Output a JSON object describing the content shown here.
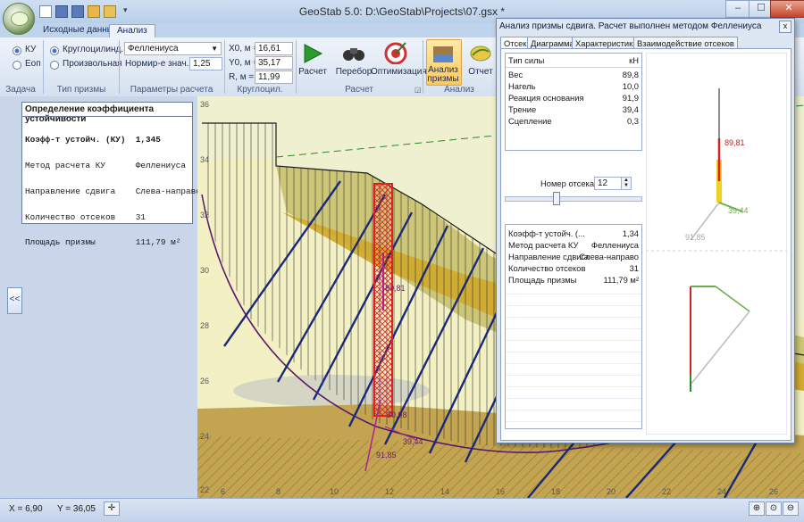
{
  "window": {
    "title": "GeoStab 5.0:  D:\\GeoStab\\Projects\\07.gsx *",
    "minimize_label": "–",
    "maximize_label": "☐",
    "close_label": "✕"
  },
  "ribbon_tabs": [
    "Исходные данные",
    "Анализ"
  ],
  "ribbon": {
    "task_group": {
      "caption": "Задача",
      "options": [
        "КУ",
        "Еоп"
      ]
    },
    "prism_group": {
      "caption": "Тип призмы",
      "options": [
        "Круглоцилинд.",
        "Произвольная"
      ]
    },
    "calc_params": {
      "caption": "Параметры расчета",
      "method": "Феллениуса",
      "norm_label": "Нормир-е знач. Ку",
      "norm_value": "1,25"
    },
    "circle_prism": {
      "caption": "Круглоцил. призма",
      "x0_label": "X0, м =",
      "x0": "16,61",
      "y0_label": "Y0, м =",
      "y0": "35,17",
      "r_label": "R, м =",
      "r": "11,99"
    },
    "calc_group": {
      "caption": "Расчет",
      "calc": "Расчет",
      "search": "Перебор",
      "optimize": "Оптимизация"
    },
    "analysis_group": {
      "caption": "Анализ",
      "prism_analysis_l1": "Анализ",
      "prism_analysis_l2": "призмы",
      "report": "Отчет"
    }
  },
  "left_panel": {
    "title": "Определение коэффициента устойчивости",
    "lines": [
      "Коэфф-т устойч. (КУ)  1,345",
      "Метод расчета КУ      Феллениуса",
      "Направление сдвига    Слева-направо",
      "Количество отсеков    31",
      "Площадь призмы        111,79 м²"
    ],
    "collapse_label": "<<"
  },
  "status": {
    "x": "X = 6,90",
    "y": "Y = 36,05"
  },
  "plot": {
    "y_ticks": [
      "36",
      "34",
      "32",
      "30",
      "28",
      "26",
      "24",
      "22"
    ],
    "x_ticks": [
      "6",
      "8",
      "10",
      "12",
      "14",
      "16",
      "18",
      "20",
      "22",
      "24",
      "26"
    ],
    "labels": {
      "force_a": "89,81",
      "force_b": "30,98",
      "force_c": "91,85",
      "force_d": "39,44"
    }
  },
  "dialog": {
    "title": "Анализ призмы сдвига. Расчет выполнен методом Феллениуса",
    "tabs": [
      "Отсек",
      "Диаграмма",
      "Характеристики",
      "Взаимодействие отсеков"
    ],
    "forces_header": {
      "type": "Тип силы",
      "unit": "кН"
    },
    "forces": [
      {
        "k": "Вес",
        "v": "89,8"
      },
      {
        "k": "Нагель",
        "v": "10,0"
      },
      {
        "k": "Реакция основания",
        "v": "91,9"
      },
      {
        "k": "Трение",
        "v": "39,4"
      },
      {
        "k": "Сцепление",
        "v": "0,3"
      }
    ],
    "section_label": "Номер отсека",
    "section_value": "12",
    "summary": [
      {
        "k": "Коэфф-т устойч. (...",
        "v": "1,34"
      },
      {
        "k": "Метод расчета КУ",
        "v": "Феллениуса"
      },
      {
        "k": "Направление сдвига",
        "v": "Слева-направо"
      },
      {
        "k": "Количество отсеков",
        "v": "31"
      },
      {
        "k": "Площадь призмы",
        "v": "111,79 м²"
      }
    ],
    "diagram_labels": {
      "weight": "89,81",
      "friction": "39,44",
      "reaction": "91,85"
    },
    "close_label": "x"
  },
  "colors": {
    "accent": "#3b74d6",
    "force_red": "#d42020",
    "nail_blue": "#1a2a7a",
    "soil_yellow": "#f3f0c4"
  }
}
